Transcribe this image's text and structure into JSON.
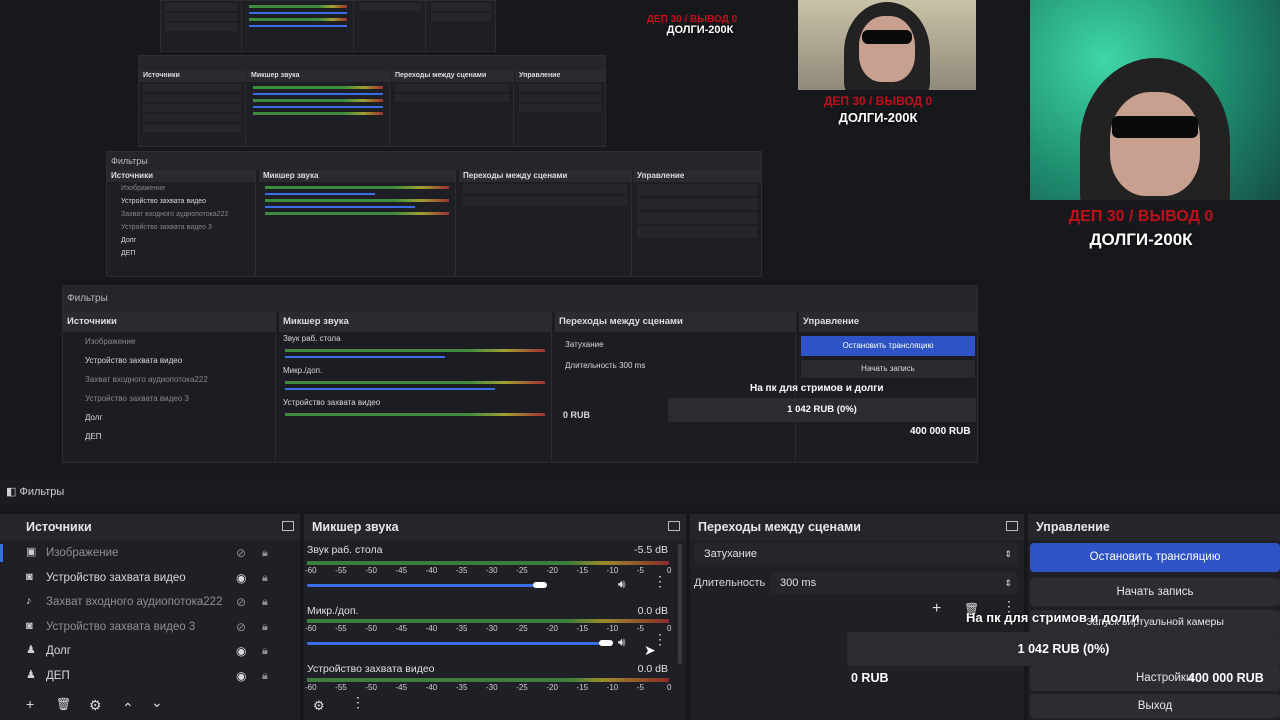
{
  "app": {
    "filters_tab": "Фильтры"
  },
  "sources": {
    "title": "Источники",
    "items": [
      {
        "label": "Изображение",
        "icon": "image-icon",
        "visible": false
      },
      {
        "label": "Устройство захвата видео",
        "icon": "camera-icon",
        "visible": true
      },
      {
        "label": "Захват входного аудиопотока222",
        "icon": "microphone-icon",
        "visible": false
      },
      {
        "label": "Устройство захвата видео 3",
        "icon": "camera-icon",
        "visible": false
      },
      {
        "label": "Долг",
        "icon": "people-icon",
        "visible": true
      },
      {
        "label": "ДЕП",
        "icon": "people-icon",
        "visible": true
      }
    ],
    "toolbar": {
      "add": "+",
      "remove": "🗑",
      "settings": "⚙",
      "up": "⌃",
      "down": "⌄"
    }
  },
  "mixer": {
    "title": "Микшер звука",
    "scale": [
      "-60",
      "-55",
      "-50",
      "-45",
      "-40",
      "-35",
      "-30",
      "-25",
      "-20",
      "-15",
      "-10",
      "-5",
      "0"
    ],
    "channels": [
      {
        "name": "Звук раб. стола",
        "db": "-5.5 dB",
        "level": 0.78
      },
      {
        "name": "Микр./доп.",
        "db": "0.0 dB",
        "level": 1.0
      },
      {
        "name": "Устройство захвата видео",
        "db": "0.0 dB",
        "level": 1.0
      }
    ]
  },
  "transitions": {
    "title": "Переходы между сценами",
    "selected": "Затухание",
    "duration_label": "Длительность",
    "duration_value": "300 ms"
  },
  "controls": {
    "title": "Управление",
    "stop_stream": "Остановить трансляцию",
    "start_record": "Начать запись",
    "virtual_cam": "Запуск виртуальной камеры",
    "settings": "Настройки",
    "exit": "Выход"
  },
  "donation_overlay": {
    "goal_title": "На пк для стримов и долги",
    "progress_text": "1 042 RUB (0%)",
    "progress": 0.0,
    "min": "0 RUB",
    "max": "400 000 RUB"
  },
  "stream_overlay": {
    "red_line": "ДЕП 30 / ВЫВОД 0",
    "white_line": "ДОЛГИ-200К"
  }
}
